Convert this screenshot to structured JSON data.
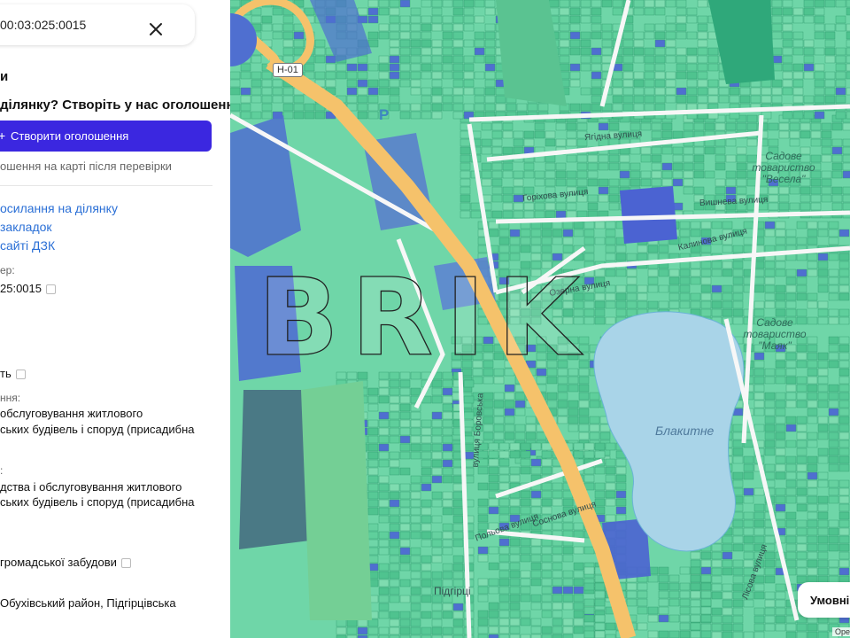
{
  "panel": {
    "cadastre_number": "00:03:025:0015",
    "heading_fragment": "и",
    "question": "ділянку? Створіть у нас оголошення!",
    "cta_icon": "+",
    "cta_label": "Створити оголошення",
    "cta_note": "ошення на карті після перевірки",
    "links": [
      "осилання на ділянку",
      "закладок",
      "сайті ДЗК"
    ],
    "cadastre_label_fragment": "ер:",
    "cadastre_value_fragment": "25:0015",
    "ownership_fragment": "ть",
    "purpose_label_fragment": "ння:",
    "purpose_line1": "обслуговування житлового",
    "purpose_line2": "ських будівель і споруд (присадибна",
    "purpose_label2_fragment": ":",
    "purpose2_line1": "дства і обслуговування житлового",
    "purpose2_line2": "ських будівель і споруд (присадибна",
    "zone_fragment": "громадської забудови",
    "address_fragment": "Обухівський район, Підгірцівська"
  },
  "map": {
    "road_number": "Н-01",
    "parking_symbol": "P",
    "lake_name": "Блакитне",
    "coop_label_1": "Садове товариство \"Маяк\"",
    "coop_label_2": "Садове товариство \"Весела\"",
    "settlement_label": "Підгірці",
    "street_labels": [
      "Ягідна вулиця",
      "Вишнева вулиця",
      "Калинова вулиця",
      "Горіхова вулиця",
      "Озерна вулиця",
      "вулиця Боровська",
      "Польова вулиця",
      "Соснова вулиця",
      "Лісова вулиця"
    ],
    "legend_button": "Умовні п",
    "attribution": "Оре",
    "watermark": "BRIK",
    "colors": {
      "parcel_green": "#5fcf9c",
      "parcel_green_dark": "#2fa87a",
      "parcel_blue": "#4f6fd0",
      "lake": "#a9d4e8",
      "main_road": "#f5c26b",
      "street": "#f7f7f7",
      "panel_cta": "#3b27e0"
    }
  }
}
